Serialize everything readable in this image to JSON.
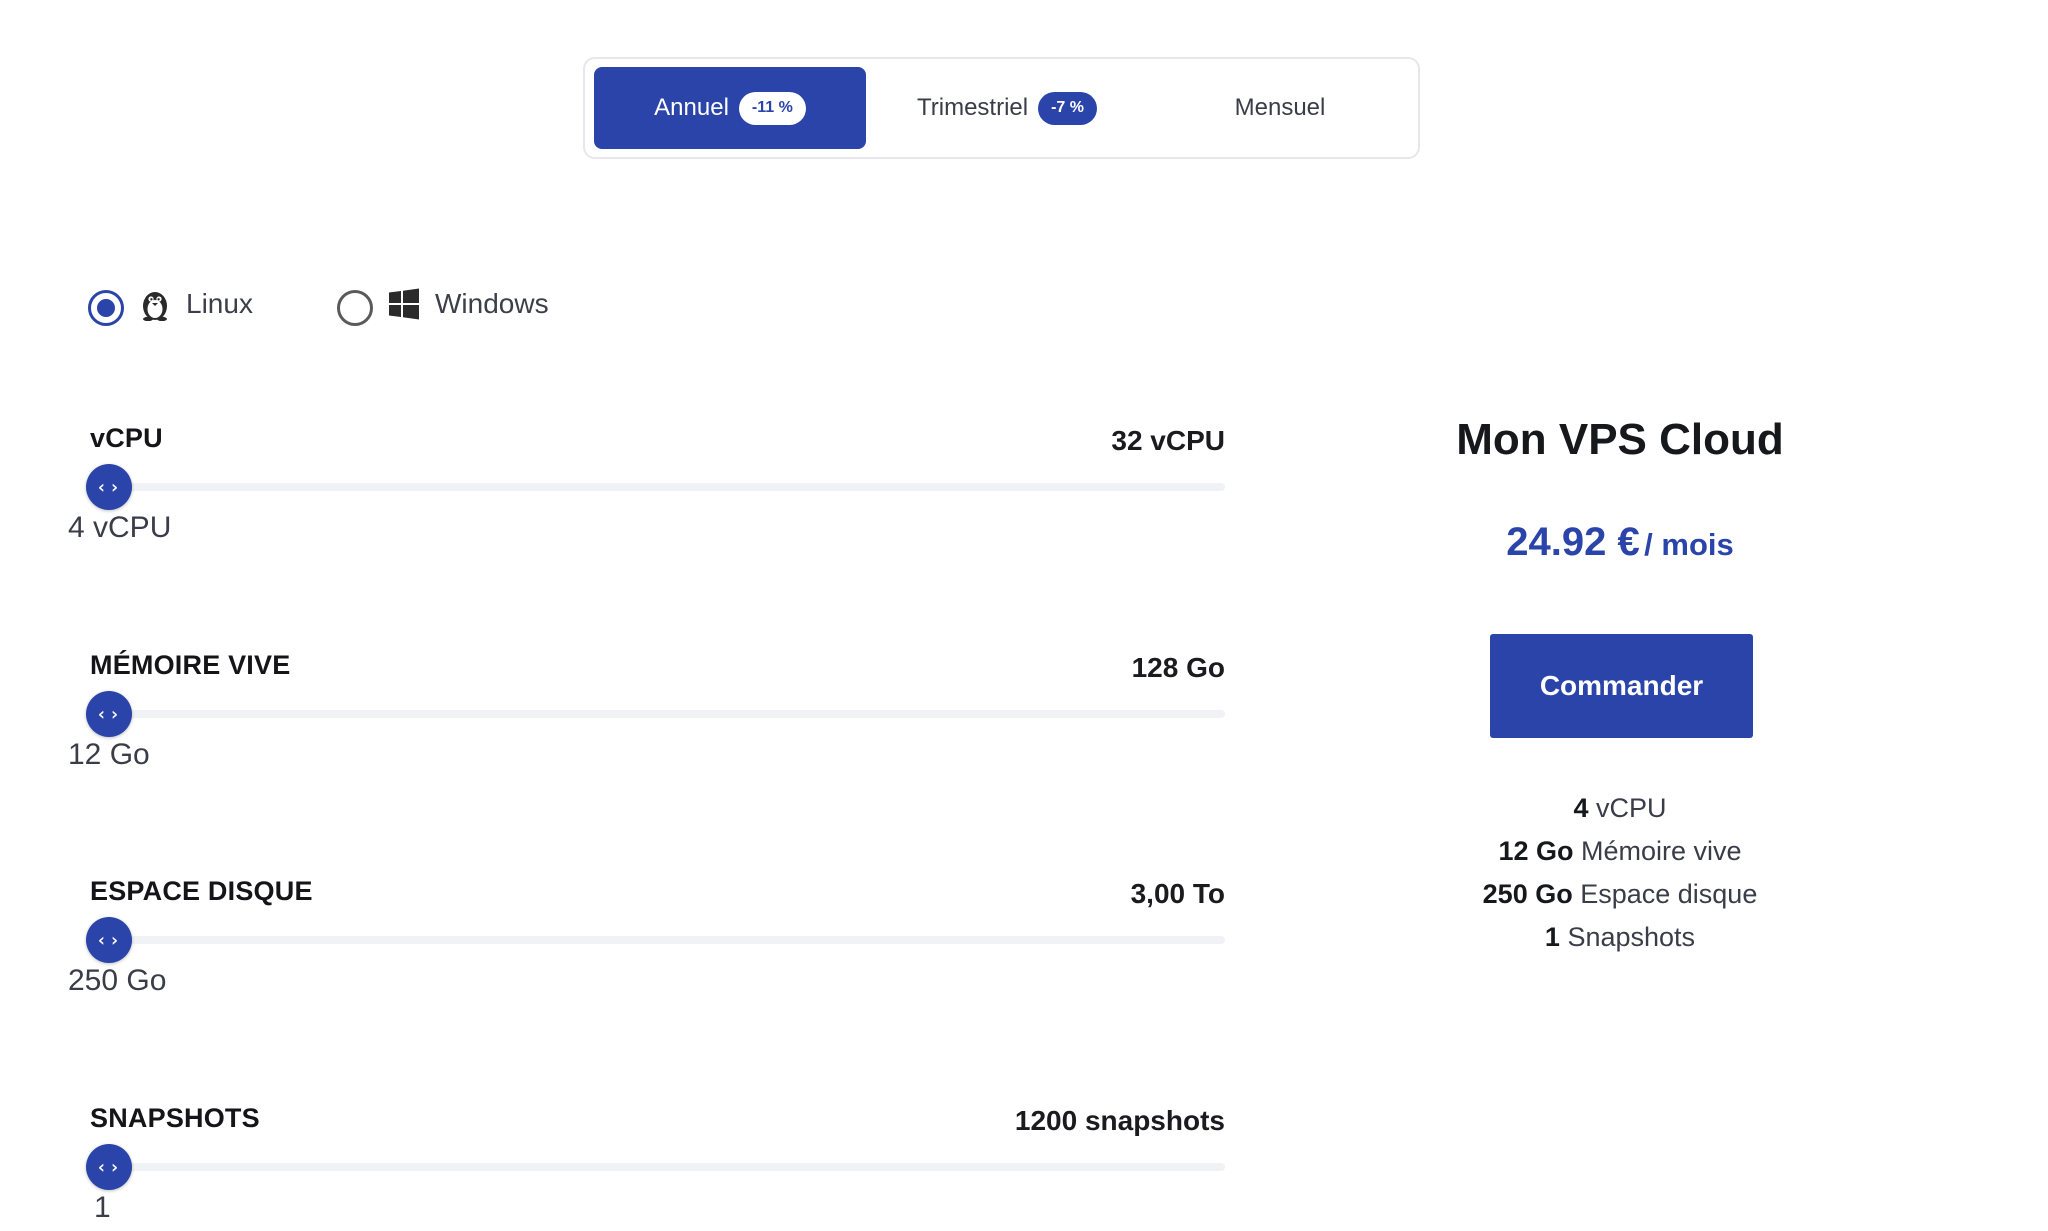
{
  "billing": {
    "tabs": [
      {
        "label": "Annuel",
        "badge": "-11 %"
      },
      {
        "label": "Trimestriel",
        "badge": "-7 %"
      },
      {
        "label": "Mensuel"
      }
    ],
    "selected": "Annuel"
  },
  "os": {
    "options": [
      {
        "label": "Linux",
        "icon": "linux-penguin-icon",
        "selected": true
      },
      {
        "label": "Windows",
        "icon": "windows-icon",
        "selected": false
      }
    ]
  },
  "sliders": [
    {
      "title": "vCPU",
      "max_label": "32 vCPU",
      "value_label": "4 vCPU"
    },
    {
      "title": "MÉMOIRE VIVE",
      "max_label": "128 Go",
      "value_label": "12 Go"
    },
    {
      "title": "ESPACE DISQUE",
      "max_label": "3,00 To",
      "value_label": "250 Go"
    },
    {
      "title": "SNAPSHOTS",
      "max_label": "1200 snapshots",
      "value_label": "1"
    }
  ],
  "summary": {
    "title": "Mon VPS Cloud",
    "price": "24.92 €",
    "period": "/ mois",
    "order_label": "Commander",
    "specs": [
      {
        "value": "4",
        "label": "vCPU"
      },
      {
        "value": "12 Go",
        "label": "Mémoire vive"
      },
      {
        "value": "250 Go",
        "label": "Espace disque"
      },
      {
        "value": "1",
        "label": "Snapshots"
      }
    ]
  },
  "colors": {
    "accent": "#2b44a9",
    "track": "#f1f2f5",
    "text_dark": "#17181c",
    "text_muted": "#3a3d48"
  }
}
